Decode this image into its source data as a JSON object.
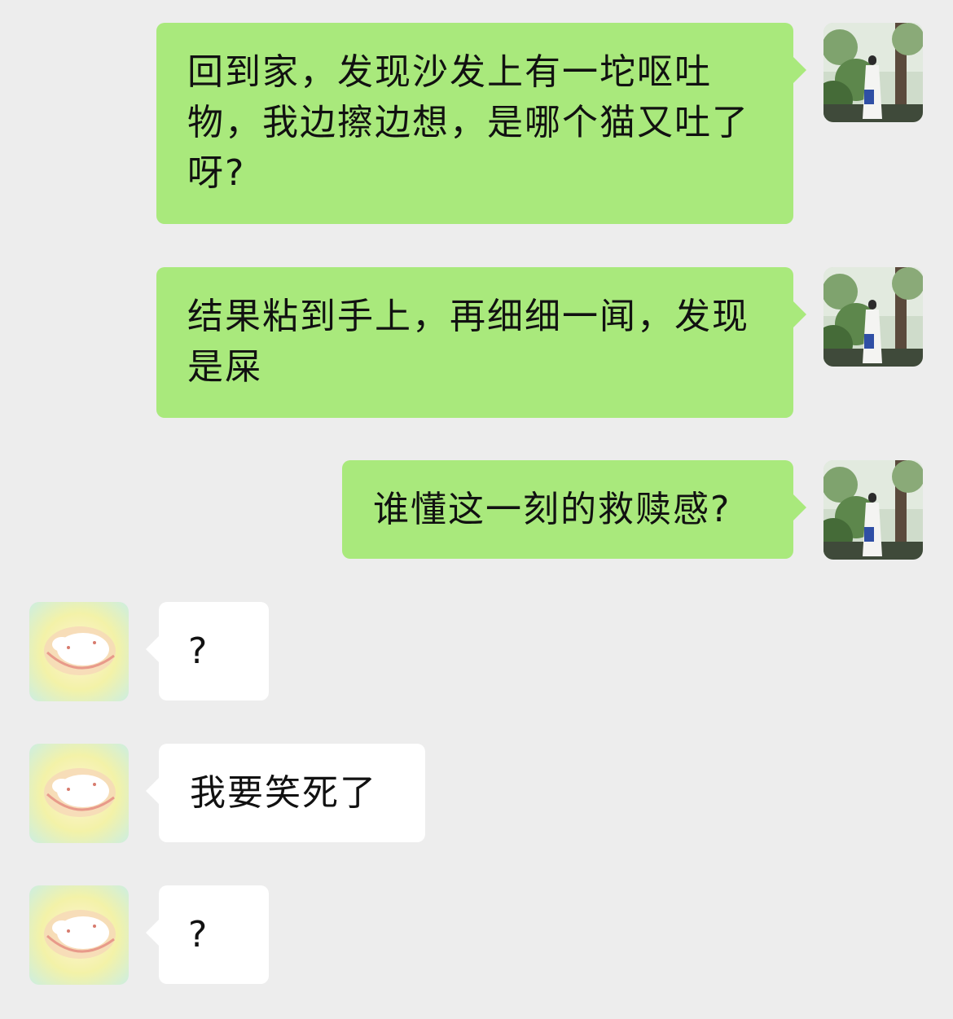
{
  "chat": {
    "messages": [
      {
        "direction": "sent",
        "text": "回到家，发现沙发上有一坨呕吐物，我边擦边想，是哪个猫又吐了呀?",
        "avatar_icon": "user-avatar-photo-icon"
      },
      {
        "direction": "sent",
        "text": "结果粘到手上，再细细一闻，发现是屎",
        "avatar_icon": "user-avatar-photo-icon"
      },
      {
        "direction": "sent",
        "text": "谁懂这一刻的救赎感?",
        "avatar_icon": "user-avatar-photo-icon"
      },
      {
        "direction": "received",
        "text": "?",
        "avatar_icon": "friend-avatar-cat-icon"
      },
      {
        "direction": "received",
        "text": "我要笑死了",
        "avatar_icon": "friend-avatar-cat-icon"
      },
      {
        "direction": "received",
        "text": "?",
        "avatar_icon": "friend-avatar-cat-icon"
      }
    ]
  },
  "colors": {
    "background": "#ededed",
    "sent_bubble": "#a9e97c",
    "received_bubble": "#ffffff",
    "text": "#111111"
  }
}
